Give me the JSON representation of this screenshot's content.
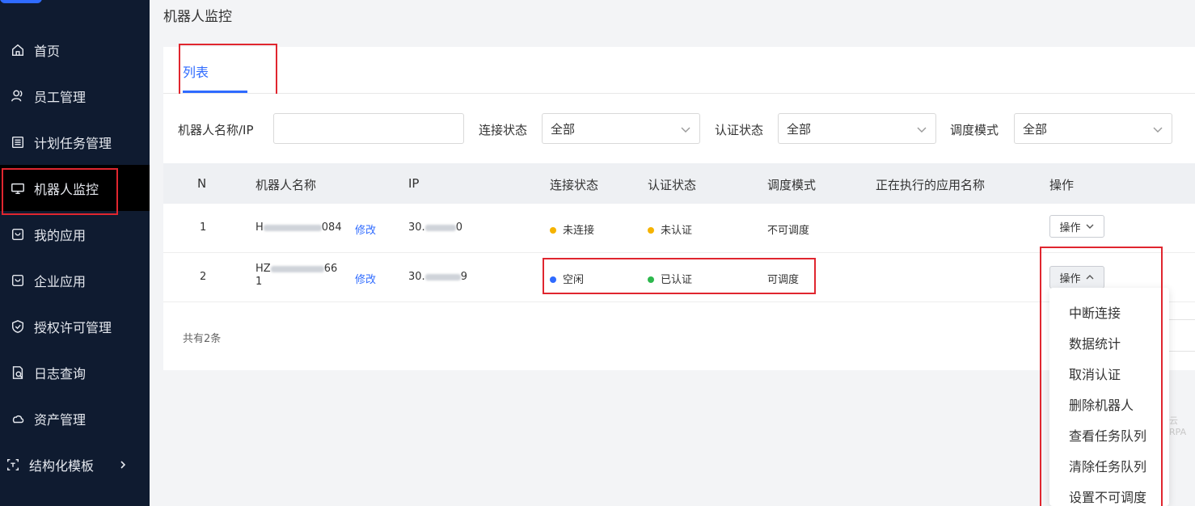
{
  "sidebar": {
    "items": [
      {
        "label": "首页",
        "icon": "home-icon"
      },
      {
        "label": "员工管理",
        "icon": "users-icon"
      },
      {
        "label": "计划任务管理",
        "icon": "list-icon"
      },
      {
        "label": "机器人监控",
        "icon": "monitor-icon",
        "active": true
      },
      {
        "label": "我的应用",
        "icon": "app-icon"
      },
      {
        "label": "企业应用",
        "icon": "app-icon"
      },
      {
        "label": "授权许可管理",
        "icon": "shield-icon"
      },
      {
        "label": "日志查询",
        "icon": "log-icon"
      },
      {
        "label": "资产管理",
        "icon": "cloud-icon"
      },
      {
        "label": "结构化模板",
        "icon": "template-icon",
        "has_children": true
      }
    ]
  },
  "page": {
    "title": "机器人监控"
  },
  "tabs": [
    {
      "label": "列表",
      "active": true
    }
  ],
  "filters": {
    "name_ip_label": "机器人名称/IP",
    "name_ip_value": "",
    "connection_label": "连接状态",
    "connection_value": "全部",
    "auth_label": "认证状态",
    "auth_value": "全部",
    "schedule_label": "调度模式",
    "schedule_value": "全部"
  },
  "table": {
    "headers": [
      "N",
      "机器人名称",
      "IP",
      "连接状态",
      "认证状态",
      "调度模式",
      "正在执行的应用名称",
      "操作"
    ],
    "rows": [
      {
        "n": "1",
        "name_prefix": "H",
        "name_suffix": "084",
        "edit": "修改",
        "ip_prefix": "30.",
        "ip_suffix": "0",
        "connection": "未连接",
        "connection_color": "#f5b300",
        "auth": "未认证",
        "auth_color": "#f5b300",
        "schedule": "不可调度",
        "app": "",
        "op": "操作"
      },
      {
        "n": "2",
        "name_prefix": "HZ",
        "name_suffix": "66",
        "name_line2": "1",
        "edit": "修改",
        "ip_prefix": "30.",
        "ip_suffix": "9",
        "connection": "空闲",
        "connection_color": "#2f6bff",
        "auth": "已认证",
        "auth_color": "#2db84d",
        "schedule": "可调度",
        "app": "",
        "op": "操作"
      }
    ],
    "total": "共有2条"
  },
  "op_menu": [
    "中断连接",
    "数据统计",
    "取消认证",
    "删除机器人",
    "查看任务队列",
    "清除任务队列",
    "设置不可调度"
  ],
  "colors": {
    "accent": "#2f6bff",
    "sidebar_bg": "#0f1b30",
    "annotation": "#e0262f"
  }
}
